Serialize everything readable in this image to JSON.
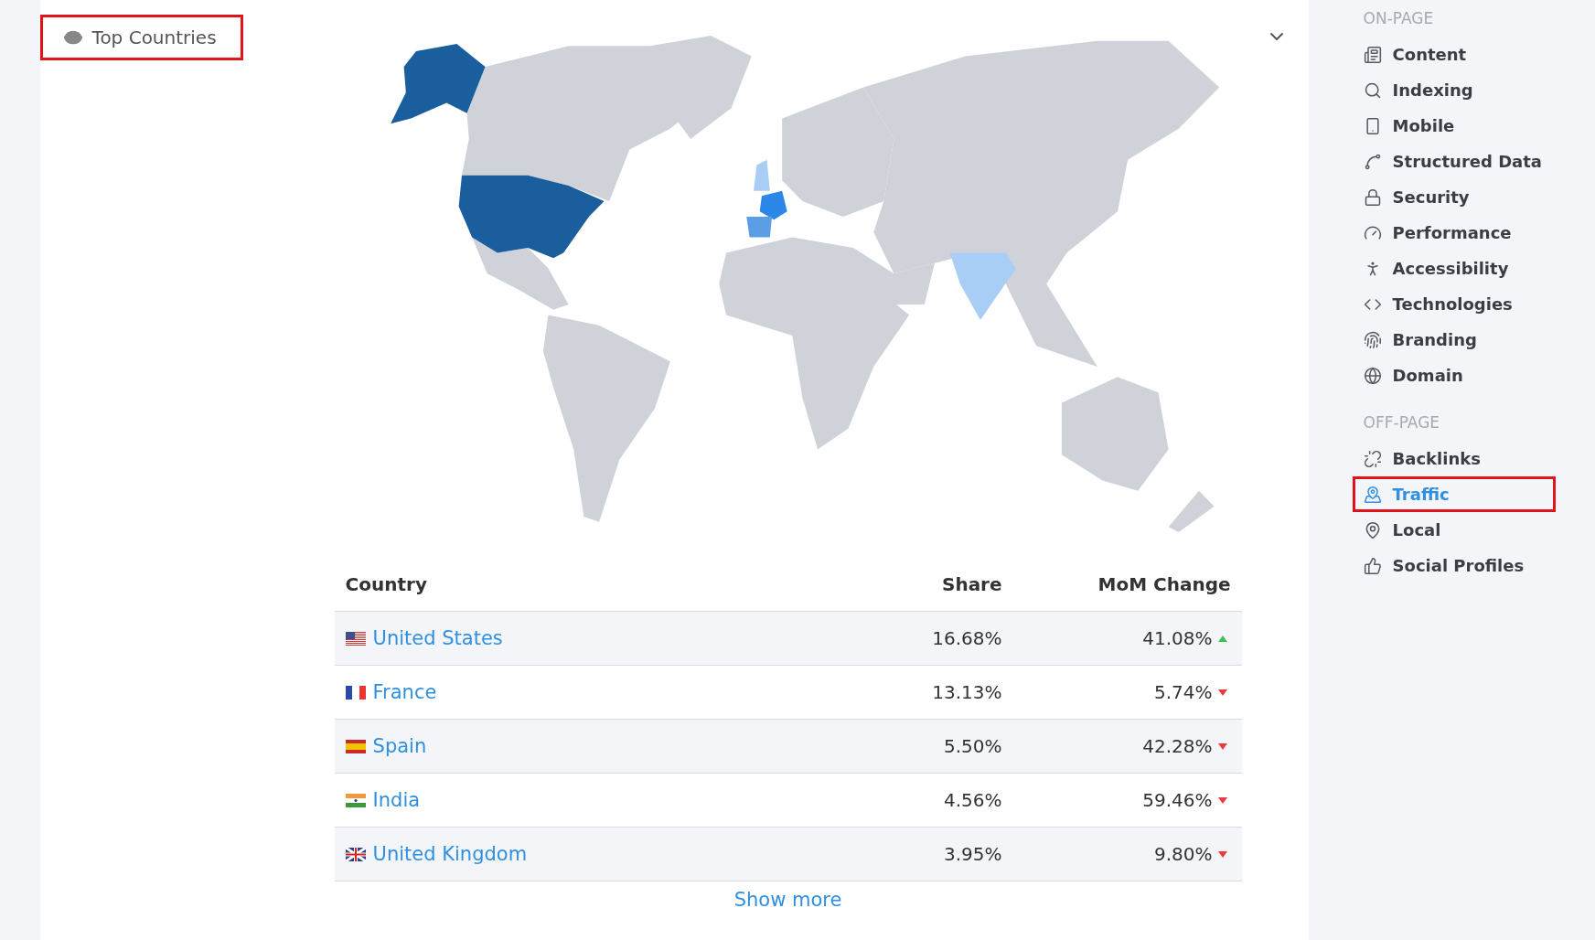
{
  "panel": {
    "title": "Top Countries",
    "title_highlighted": true
  },
  "table": {
    "columns": [
      "Country",
      "Share",
      "MoM Change"
    ],
    "rows": [
      {
        "country": "United States",
        "share": "16.68%",
        "change": "41.08%",
        "rising": true
      },
      {
        "country": "France",
        "share": "13.13%",
        "change": "5.74%",
        "rising": false
      },
      {
        "country": "Spain",
        "share": "5.50%",
        "change": "42.28%",
        "rising": false
      },
      {
        "country": "India",
        "share": "4.56%",
        "change": "59.46%",
        "rising": false
      },
      {
        "country": "United Kingdom",
        "share": "3.95%",
        "change": "9.80%",
        "rising": false
      }
    ],
    "show_more": "Show more"
  },
  "sidebar": {
    "sections": [
      {
        "heading": "ON-PAGE",
        "items": [
          {
            "label": "Content",
            "selected": false,
            "highlighted": false
          },
          {
            "label": "Indexing",
            "selected": false,
            "highlighted": false
          },
          {
            "label": "Mobile",
            "selected": false,
            "highlighted": false
          },
          {
            "label": "Structured Data",
            "selected": false,
            "highlighted": false
          },
          {
            "label": "Security",
            "selected": false,
            "highlighted": false
          },
          {
            "label": "Performance",
            "selected": false,
            "highlighted": false
          },
          {
            "label": "Accessibility",
            "selected": false,
            "highlighted": false
          },
          {
            "label": "Technologies",
            "selected": false,
            "highlighted": false
          },
          {
            "label": "Branding",
            "selected": false,
            "highlighted": false
          },
          {
            "label": "Domain",
            "selected": false,
            "highlighted": false
          }
        ]
      },
      {
        "heading": "OFF-PAGE",
        "items": [
          {
            "label": "Backlinks",
            "selected": false,
            "highlighted": false
          },
          {
            "label": "Traffic",
            "selected": true,
            "highlighted": true
          },
          {
            "label": "Local",
            "selected": false,
            "highlighted": false
          },
          {
            "label": "Social Profiles",
            "selected": false,
            "highlighted": false
          }
        ]
      }
    ]
  }
}
